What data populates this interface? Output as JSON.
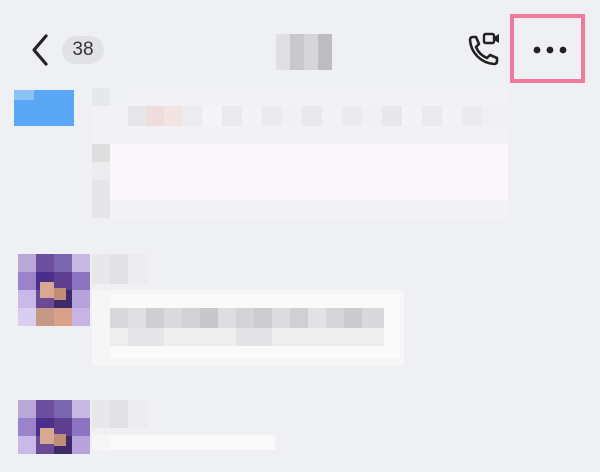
{
  "header": {
    "unread_count": "38",
    "back_icon": "chevron-left-icon",
    "call_icon": "video-call-icon",
    "more_icon": "more-horizontal-icon"
  },
  "annotation": {
    "highlight_color": "#f07a9a",
    "highlighted_element": "more-options-button"
  },
  "colors": {
    "background": "#eff0f4",
    "badge_bg": "#e1e2e6",
    "self_avatar_blue": "#5aa8f5"
  }
}
